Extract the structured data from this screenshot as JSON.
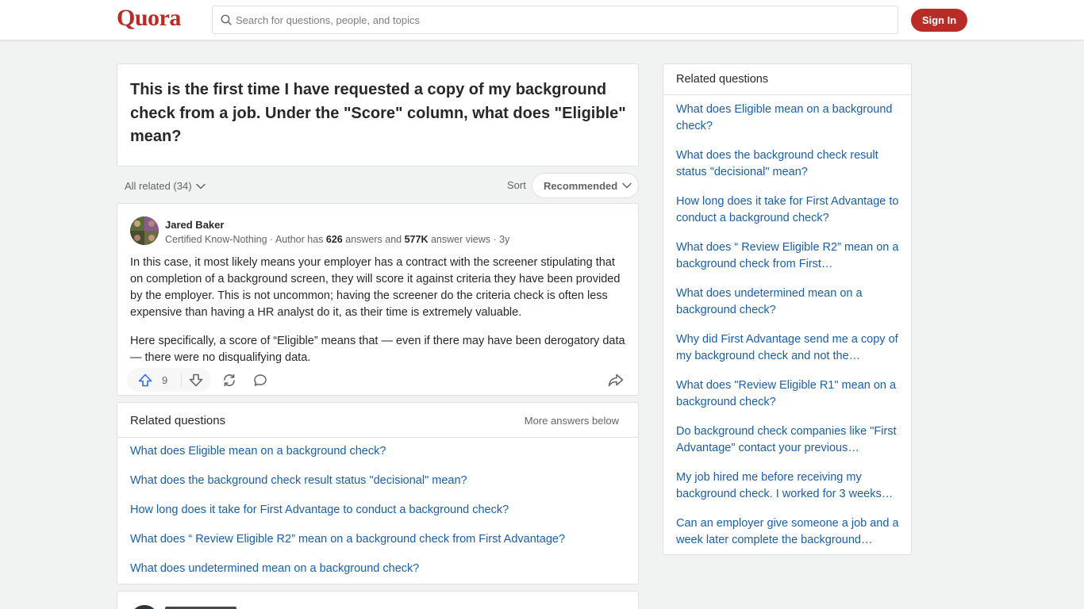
{
  "header": {
    "logo": "Quora",
    "search_placeholder": "Search for questions, people, and topics",
    "signin_label": "Sign In"
  },
  "question": {
    "title": "This is the first time I have requested a copy of my background check from a job. Under the \"Score\" column, what does \"Eligible\" mean?"
  },
  "filters": {
    "all_related": "All related (34)",
    "sort_label": "Sort",
    "sort_value": "Recommended"
  },
  "answer": {
    "author_name": "Jared Baker",
    "credential": "Certified Know-Nothing",
    "answers_prefix": "Author has ",
    "answers_count": "626",
    "answers_suffix": " answers and ",
    "views_count": "577K",
    "views_suffix": " answer views",
    "age": "3y",
    "paragraphs": [
      "In this case, it most likely means your employer has a contract with the screener stipulating that on completion of a background screen, they will score it against criteria they have been provided by the employer. This is not uncommon; having the screener do the criteria check is often less expensive than having a HR analyst do it, as their time is extremely valuable.",
      "Here specifically, a score of “Eligible” means that — even if there may have been derogatory data — there were no disqualifying data."
    ],
    "upvotes": "9"
  },
  "related_main": {
    "title": "Related questions",
    "more_label": "More answers below",
    "items": [
      "What does Eligible mean on a background check?",
      "What does the background check result status \"decisional\" mean?",
      "How long does it take for First Advantage to conduct a background check?",
      "What does “ Review Eligible R2” mean on a background check from First Advantage?",
      "What does undetermined mean on a background check?"
    ]
  },
  "sidebar": {
    "title": "Related questions",
    "items": [
      "What does Eligible mean on a background check?",
      "What does the background check result status \"decisional\" mean?",
      "How long does it take for First Advantage to conduct a background check?",
      "What does “ Review Eligible R2” mean on a background check from First…",
      "What does undetermined mean on a background check?",
      "Why did First Advantage send me a copy of my background check and not the…",
      "What does \"Review Eligible R1\" mean on a background check?",
      "Do background check companies like \"First Advantage\" contact your previous…",
      "My job hired me before receiving my background check. I worked for 3 weeks…",
      "Can an employer give someone a job and a week later complete the background…"
    ]
  },
  "colors": {
    "brand": "#b92b27",
    "link": "#195faa",
    "upvote": "#2e69ff"
  }
}
